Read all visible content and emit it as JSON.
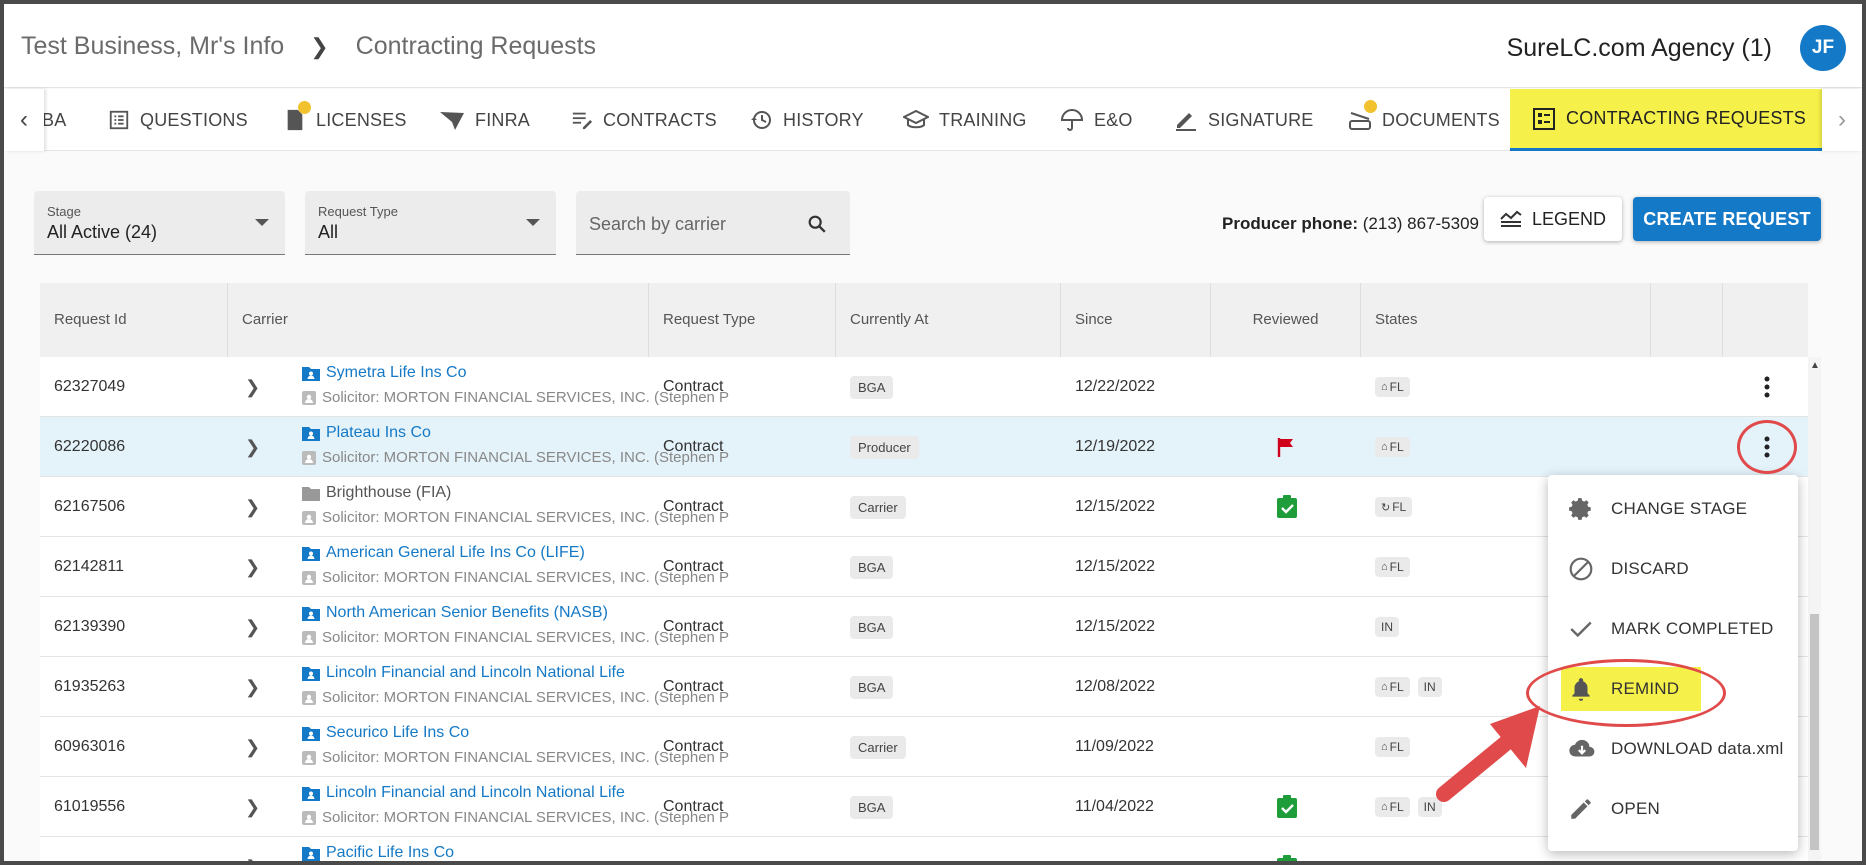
{
  "header": {
    "breadcrumb_root": "Test Business, Mr's Info",
    "breadcrumb_current": "Contracting Requests",
    "agency": "SureLC.com Agency (1)",
    "avatar_initials": "JF"
  },
  "tabs": [
    {
      "label": "BA"
    },
    {
      "label": "QUESTIONS"
    },
    {
      "label": "LICENSES"
    },
    {
      "label": "FINRA"
    },
    {
      "label": "CONTRACTS"
    },
    {
      "label": "HISTORY"
    },
    {
      "label": "TRAINING"
    },
    {
      "label": "E&O"
    },
    {
      "label": "SIGNATURE"
    },
    {
      "label": "DOCUMENTS"
    },
    {
      "label": "CONTRACTING REQUESTS"
    }
  ],
  "filters": {
    "stage_label": "Stage",
    "stage_value": "All Active (24)",
    "type_label": "Request Type",
    "type_value": "All",
    "search_placeholder": "Search by carrier"
  },
  "producer_phone_label": "Producer phone:",
  "producer_phone": "(213) 867-5309",
  "legend_button": "LEGEND",
  "create_button": "CREATE REQUEST",
  "table": {
    "columns": [
      "Request Id",
      "Carrier",
      "Request Type",
      "Currently At",
      "Since",
      "Reviewed",
      "States"
    ],
    "rows": [
      {
        "id": "62327049",
        "carrier": "Symetra Life Ins Co",
        "solicitor": "Solicitor: MORTON FINANCIAL SERVICES, INC. (Stephen P",
        "type": "Contract",
        "at": "BGA",
        "since": "12/22/2022",
        "states": [
          "FL"
        ]
      },
      {
        "id": "62220086",
        "carrier": "Plateau Ins Co",
        "solicitor": "Solicitor: MORTON FINANCIAL SERVICES, INC. (Stephen P",
        "type": "Contract",
        "at": "Producer",
        "since": "12/19/2022",
        "states": [
          "FL"
        ]
      },
      {
        "id": "62167506",
        "carrier": "Brighthouse (FIA)",
        "solicitor": "Solicitor: MORTON FINANCIAL SERVICES, INC. (Stephen P",
        "type": "Contract",
        "at": "Carrier",
        "since": "12/15/2022",
        "states": [
          "FL"
        ]
      },
      {
        "id": "62142811",
        "carrier": "American General Life Ins Co (LIFE)",
        "solicitor": "Solicitor: MORTON FINANCIAL SERVICES, INC. (Stephen P",
        "type": "Contract",
        "at": "BGA",
        "since": "12/15/2022",
        "states": [
          "FL"
        ]
      },
      {
        "id": "62139390",
        "carrier": "North American Senior Benefits (NASB)",
        "solicitor": "Solicitor: MORTON FINANCIAL SERVICES, INC. (Stephen P",
        "type": "Contract",
        "at": "BGA",
        "since": "12/15/2022",
        "states": [
          "IN"
        ]
      },
      {
        "id": "61935263",
        "carrier": "Lincoln Financial and Lincoln National Life",
        "solicitor": "Solicitor: MORTON FINANCIAL SERVICES, INC. (Stephen P",
        "type": "Contract",
        "at": "BGA",
        "since": "12/08/2022",
        "states": [
          "FL",
          "IN"
        ]
      },
      {
        "id": "60963016",
        "carrier": "Securico Life Ins Co",
        "solicitor": "Solicitor: MORTON FINANCIAL SERVICES, INC. (Stephen P",
        "type": "Contract",
        "at": "Carrier",
        "since": "11/09/2022",
        "states": [
          "FL"
        ]
      },
      {
        "id": "61019556",
        "carrier": "Lincoln Financial and Lincoln National Life",
        "solicitor": "Solicitor: MORTON FINANCIAL SERVICES, INC. (Stephen P",
        "type": "Contract",
        "at": "BGA",
        "since": "11/04/2022",
        "states": [
          "FL",
          "IN"
        ]
      },
      {
        "id": "",
        "carrier": "Pacific Life Ins Co",
        "solicitor": "",
        "type": "",
        "at": "",
        "since": "",
        "states": []
      }
    ]
  },
  "menu": {
    "items": [
      {
        "label": "CHANGE STAGE"
      },
      {
        "label": "DISCARD"
      },
      {
        "label": "MARK COMPLETED"
      },
      {
        "label": "REMIND"
      },
      {
        "label": "DOWNLOAD data.xml"
      },
      {
        "label": "OPEN"
      }
    ]
  },
  "colors": {
    "accent": "#1479c6",
    "highlight": "#f5f04a",
    "annotation": "#e04a4a",
    "flag": "#d0021b",
    "check": "#1f9d3a"
  }
}
